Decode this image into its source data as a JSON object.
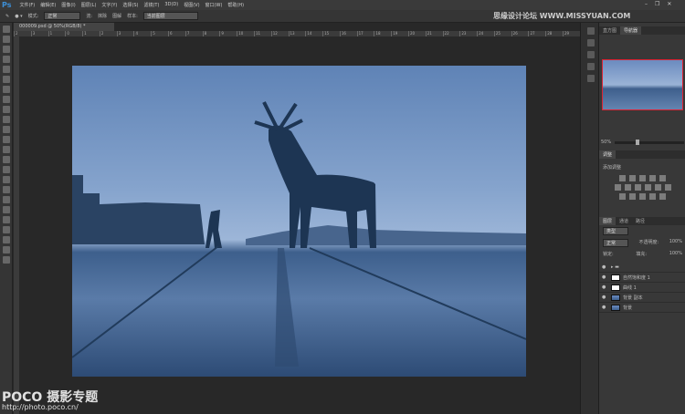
{
  "app": {
    "logo": "Ps"
  },
  "menu": [
    "文件(F)",
    "编辑(E)",
    "图像(I)",
    "图层(L)",
    "文字(Y)",
    "选择(S)",
    "滤镜(T)",
    "3D(D)",
    "视图(V)",
    "窗口(W)",
    "帮助(H)"
  ],
  "window_controls": [
    "–",
    "❐",
    "✕"
  ],
  "options": {
    "mode_label": "模式:",
    "mode_value": "正常",
    "flow_label": "流:",
    "opt1": "抹除",
    "opt2": "图解",
    "sample_label": "样本:",
    "sample_value": "当前图层"
  },
  "document": {
    "tab": "000009.psd @ 50%(RGB/8) *"
  },
  "ruler": [
    "2",
    "3",
    "1",
    "0",
    "1",
    "2",
    "3",
    "4",
    "5",
    "6",
    "7",
    "8",
    "9",
    "10",
    "11",
    "12",
    "13",
    "14",
    "15",
    "16",
    "17",
    "18",
    "19",
    "20",
    "21",
    "22",
    "23",
    "24",
    "25",
    "26",
    "27",
    "28",
    "29"
  ],
  "panels": {
    "top_tabs": [
      "直方图",
      "导航器"
    ],
    "zoom": "50%",
    "adjust_tab": "调整",
    "adjust_title": "添加调整",
    "layer_tabs": [
      "图层",
      "通道",
      "路径"
    ],
    "kind": "类型",
    "blend": "正常",
    "opacity_label": "不透明度:",
    "opacity": "100%",
    "lock_label": "锁定:",
    "fill_label": "填充:",
    "fill": "100%",
    "layers": [
      {
        "name": "",
        "type": "group"
      },
      {
        "name": "自然饱和度 1",
        "type": "adj"
      },
      {
        "name": "曲线 1",
        "type": "adj"
      },
      {
        "name": "背景 副本",
        "type": "photo"
      },
      {
        "name": "背景",
        "type": "photo"
      }
    ]
  },
  "watermarks": {
    "top": "思缘设计论坛 WWW.MISSYUAN.COM",
    "bottom_brand": "POCO 摄影专题",
    "bottom_url": "http://photo.poco.cn/"
  }
}
